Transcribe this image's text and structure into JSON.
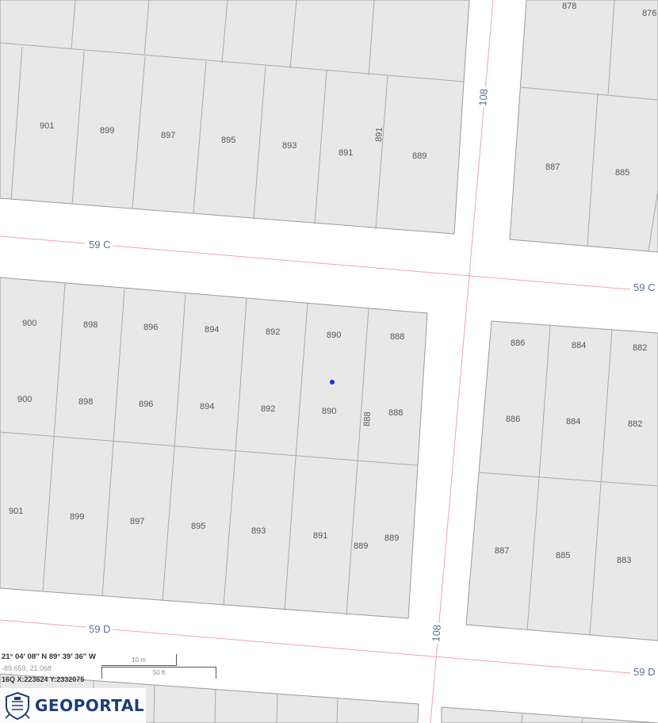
{
  "map": {
    "streets": [
      {
        "label": "59 C"
      },
      {
        "label": "59 C"
      },
      {
        "label": "59 D"
      },
      {
        "label": "59 D"
      },
      {
        "label": "108"
      },
      {
        "label": "108"
      }
    ],
    "lots": [
      {
        "label": "901"
      },
      {
        "label": "899"
      },
      {
        "label": "897"
      },
      {
        "label": "895"
      },
      {
        "label": "893"
      },
      {
        "label": "891"
      },
      {
        "label": "891"
      },
      {
        "label": "889"
      },
      {
        "label": "878"
      },
      {
        "label": "876"
      },
      {
        "label": "887"
      },
      {
        "label": "885"
      },
      {
        "label": "900"
      },
      {
        "label": "898"
      },
      {
        "label": "896"
      },
      {
        "label": "894"
      },
      {
        "label": "892"
      },
      {
        "label": "890"
      },
      {
        "label": "888"
      },
      {
        "label": "900"
      },
      {
        "label": "898"
      },
      {
        "label": "896"
      },
      {
        "label": "894"
      },
      {
        "label": "892"
      },
      {
        "label": "890"
      },
      {
        "label": "888"
      },
      {
        "label": "888"
      },
      {
        "label": "901"
      },
      {
        "label": "899"
      },
      {
        "label": "897"
      },
      {
        "label": "895"
      },
      {
        "label": "893"
      },
      {
        "label": "891"
      },
      {
        "label": "889"
      },
      {
        "label": "889"
      },
      {
        "label": "886"
      },
      {
        "label": "884"
      },
      {
        "label": "882"
      },
      {
        "label": "886"
      },
      {
        "label": "884"
      },
      {
        "label": "882"
      },
      {
        "label": "887"
      },
      {
        "label": "885"
      },
      {
        "label": "883"
      }
    ],
    "marker_color": "#1a2ee0"
  },
  "coords": {
    "dms": "21° 04′ 08″ N 89° 39′ 36″ W",
    "decimal": "-89.659, 21.068",
    "utm": "16Q X:223624 Y:2332075"
  },
  "scale": {
    "metric": "10 m",
    "imperial": "50 ft"
  },
  "brand": {
    "name": "GEOPORTAL",
    "color": "#1f3c78"
  }
}
